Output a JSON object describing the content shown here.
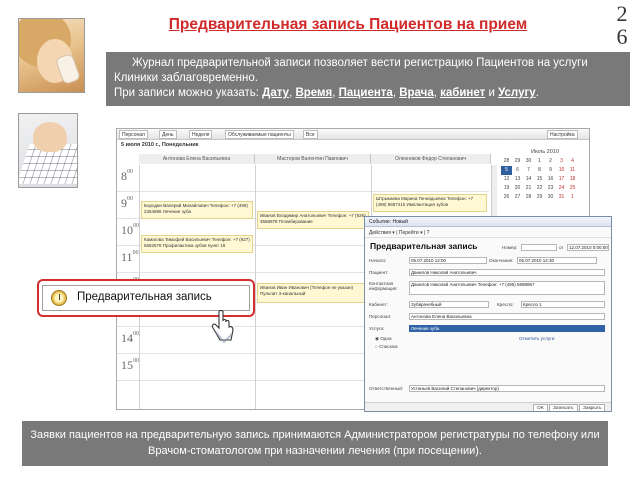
{
  "slide": {
    "title": "Предварительная запись Пациентов на прием",
    "page_number_digits": [
      "2",
      "6"
    ],
    "intro": {
      "line1": "Журнал предварительной записи позволяет вести регистрацию Пациентов на услуги",
      "line2": "Клиники заблаговременно.",
      "line3_prefix": "При записи можно указать: ",
      "items": [
        "Дату",
        "Время",
        "Пациента",
        "Врача",
        "кабинет",
        "Услугу"
      ],
      "sep_comma": ", ",
      "sep_and": " и ",
      "end": "."
    },
    "footer": "Заявки пациентов на предварительную запись принимаются Администратором регистратуры по телефону или Врачом-стоматологом при назначении лечения (при посещении)."
  },
  "app": {
    "toolbar": [
      "Персонал",
      "День",
      "Неделя",
      "Обслуживаемые пациенты",
      "Все",
      "Настройка"
    ],
    "date": "5 июля 2010 г., Понедельник",
    "doctors": [
      "Антонова Елена Васильевна",
      "Мастеров Валентин Павлович",
      "Оленников Федор Степанович"
    ],
    "hours": [
      "8",
      "9",
      "10",
      "11",
      "12",
      "13",
      "14",
      "15"
    ],
    "minutes": "00",
    "entries": [
      "Бородин Валерий Михайлович Телефон: +7 (499) 2354896 Лечение зуба",
      "Штрыкаева Марина Геннадьевна Телефон: +7 (499) 5687415 Имплантация зубов",
      "Иванов Владимир Анатольевич Телефон: +7 (926) 3568978 Пломбирование",
      "Камагова Тимофей Васильевич Телефон: +7 (927) 5682578 Профилактика зубов пункт 18",
      "Иванов Иван Иванович (Телефон не указан) Пульпит 3-канальный"
    ],
    "calendar": {
      "title": "Июль 2010",
      "days": [
        "28",
        "29",
        "30",
        "1",
        "2",
        "3",
        "4",
        "5",
        "6",
        "7",
        "8",
        "9",
        "10",
        "11",
        "12",
        "13",
        "14",
        "15",
        "16",
        "17",
        "18",
        "19",
        "20",
        "21",
        "22",
        "23",
        "24",
        "25",
        "26",
        "27",
        "28",
        "29",
        "30",
        "31",
        "1"
      ],
      "selected": "5"
    }
  },
  "callout": {
    "label": "Предварительная запись",
    "icon": "clock-icon"
  },
  "dialog": {
    "title": "Событие: Новый",
    "toolbar": "Действия ▾  |  Перейти ▾  |  ?",
    "heading": "Предварительная запись",
    "number_label": "Номер:",
    "from_label": "от",
    "from_value": "12.07.2010 0:00:00",
    "start_label": "Начало:",
    "start_value": "05.07.2010 12:00",
    "end_label": "Окончание:",
    "end_value": "05.07.2010 12:30",
    "patient_label": "Пациент:",
    "patient_value": "Данилов Николай Анатольевич",
    "contact_label": "Контактная информация:",
    "contact_value": "Данилов Николай Анатольевич Телефон: +7 (495) 5698957",
    "cabinet_label": "Кабинет:",
    "cabinet_value": "Зубврачебный",
    "chair_label": "Кресло:",
    "chair_value": "Кресло 1",
    "staff_label": "Персонал:",
    "staff_value": "Антонова Елена Васильевна",
    "service_label": "Услуга:",
    "service_value": "Лечение зуба",
    "option_one": "Одна",
    "option_list": "Списком",
    "mark_link": "Отметить услуги",
    "responsible_label": "Ответственный:",
    "responsible_value": "Устиньев Василий Степанович (директор)",
    "buttons": [
      "OK",
      "Записать",
      "Закрыть"
    ]
  },
  "colors": {
    "title_red": "#d02a2a",
    "box_grey": "#797979",
    "callout_red": "#d42e2e"
  }
}
